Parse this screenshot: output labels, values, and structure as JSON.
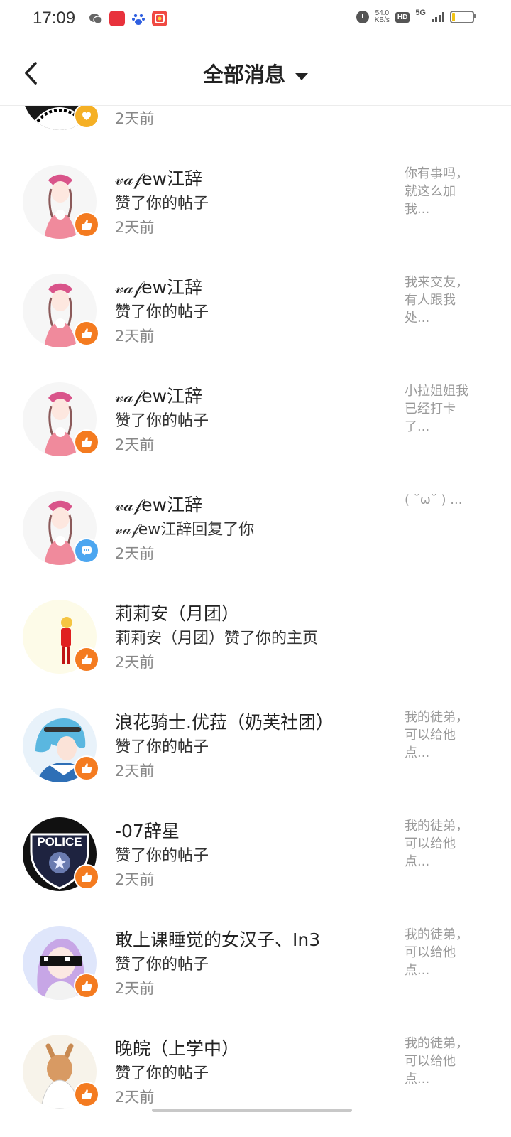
{
  "status_bar": {
    "time": "17:09",
    "net_speed_value": "54.0",
    "net_speed_unit": "KB/s",
    "hd_label": "HD",
    "network_label": "5G",
    "battery_level": 0.15
  },
  "header": {
    "title": "全部消息"
  },
  "colors": {
    "like_badge": "#f47b20",
    "comment_badge": "#4ca6f0",
    "heart_badge": "#f5b025"
  },
  "messages": [
    {
      "name": "",
      "action": "",
      "time": "2天前",
      "snippet": "",
      "badge": "heart-icon"
    },
    {
      "name": "𝓋𝒶𝒻ew江辞",
      "action": "赞了你的帖子",
      "time": "2天前",
      "snippet": "你有事吗，就这么加我...",
      "badge": "thumbs-up-icon"
    },
    {
      "name": "𝓋𝒶𝒻ew江辞",
      "action": "赞了你的帖子",
      "time": "2天前",
      "snippet": "我来交友，有人跟我处...",
      "badge": "thumbs-up-icon"
    },
    {
      "name": "𝓋𝒶𝒻ew江辞",
      "action": "赞了你的帖子",
      "time": "2天前",
      "snippet": "小拉姐姐我已经打卡了...",
      "badge": "thumbs-up-icon"
    },
    {
      "name": "𝓋𝒶𝒻ew江辞",
      "action": "𝓋𝒶𝒻ew江辞回复了你",
      "time": "2天前",
      "snippet": "( ˘ω˘ ) ...",
      "badge": "comment-icon"
    },
    {
      "name": "莉莉安（月团）",
      "action": "莉莉安（月团）赞了你的主页",
      "time": "2天前",
      "snippet": "",
      "badge": "thumbs-up-icon"
    },
    {
      "name": "浪花骑士.优菈（奶芙社团）",
      "action": "赞了你的帖子",
      "time": "2天前",
      "snippet": "我的徒弟，可以给他点...",
      "badge": "thumbs-up-icon"
    },
    {
      "name": "-07辞星",
      "action": "赞了你的帖子",
      "time": "2天前",
      "snippet": "我的徒弟，可以给他点...",
      "badge": "thumbs-up-icon",
      "avatar_text": "POLICE"
    },
    {
      "name": "敢上课睡觉的女汉子、In3",
      "action": "赞了你的帖子",
      "time": "2天前",
      "snippet": "我的徒弟，可以给他点...",
      "badge": "thumbs-up-icon"
    },
    {
      "name": "晚皖（上学中）",
      "action": "赞了你的帖子",
      "time": "2天前",
      "snippet": "我的徒弟，可以给他点...",
      "badge": "thumbs-up-icon"
    }
  ]
}
